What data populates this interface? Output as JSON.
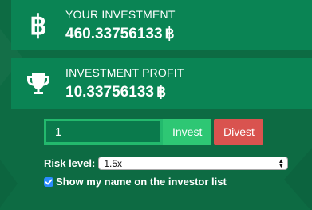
{
  "investment": {
    "label": "YOUR INVESTMENT",
    "value": "460.33756133",
    "currency": "฿",
    "icon": "bitcoin-icon"
  },
  "profit": {
    "label": "INVESTMENT PROFIT",
    "value": "10.33756133",
    "currency": "฿",
    "icon": "trophy-icon"
  },
  "form": {
    "amount_value": "1",
    "invest_label": "Invest",
    "divest_label": "Divest",
    "risk_label": "Risk level:",
    "risk_selected": "1.5x",
    "show_name_label": "Show my name on the investor list",
    "show_name_checked": true
  },
  "colors": {
    "background": "#0d6b43",
    "card": "#0a8454",
    "invest": "#2ec774",
    "divest": "#d9534f",
    "checkbox": "#2a8cff"
  }
}
